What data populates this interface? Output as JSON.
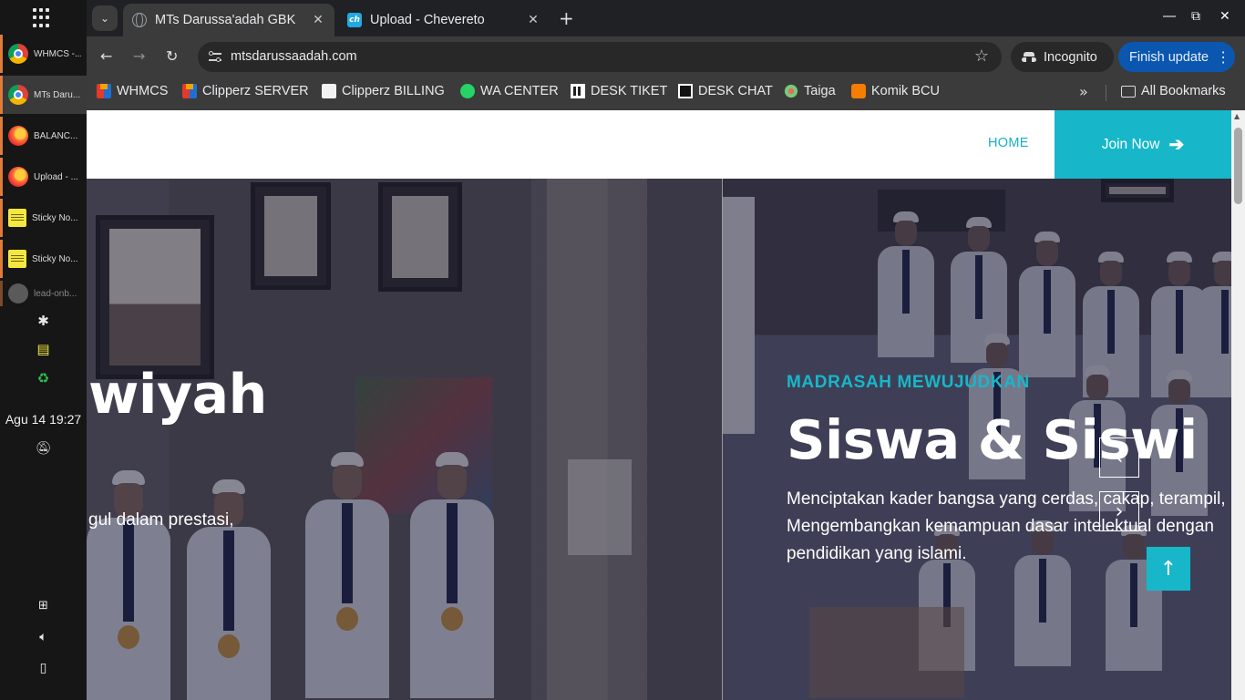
{
  "dock": {
    "windows": [
      {
        "label": "WHMCS -...",
        "icon": "chrome-icon",
        "active": false
      },
      {
        "label": "MTs Daru...",
        "icon": "chrome-icon",
        "active": true
      },
      {
        "label": "BALANC...",
        "icon": "firefox-icon",
        "active": false
      },
      {
        "label": "Upload - ...",
        "icon": "firefox-icon",
        "active": false
      },
      {
        "label": "Sticky No...",
        "icon": "sticky-notes-icon",
        "active": false
      },
      {
        "label": "Sticky No...",
        "icon": "sticky-notes-icon",
        "active": false
      },
      {
        "label": "lead-onb...",
        "icon": "app-icon",
        "active": false
      }
    ],
    "clock": "Agu 14  19:27"
  },
  "browser": {
    "tabs": [
      {
        "title": "MTs Darussa'adah GBK",
        "favicon": "globe-icon",
        "active": true
      },
      {
        "title": "Upload - Chevereto",
        "favicon": "chevereto-icon",
        "active": false
      }
    ],
    "favicon_text": "ch",
    "url": "mtsdarussaadah.com",
    "incognito_label": "Incognito",
    "update_label": "Finish update",
    "bookmarks": [
      {
        "label": "WHMCS",
        "icon": "cube-icon"
      },
      {
        "label": "Clipperz SERVER",
        "icon": "cube-icon"
      },
      {
        "label": "Clipperz BILLING",
        "icon": "clipperz-icon"
      },
      {
        "label": "WA CENTER",
        "icon": "whatsapp-icon"
      },
      {
        "label": "DESK TIKET",
        "icon": "desk-icon"
      },
      {
        "label": "DESK CHAT",
        "icon": "desk-chat-icon"
      },
      {
        "label": "Taiga",
        "icon": "taiga-icon"
      },
      {
        "label": "Komik BCU",
        "icon": "blogger-icon"
      }
    ],
    "all_bookmarks": "All Bookmarks"
  },
  "site": {
    "nav": {
      "home": "HOME",
      "join": "Join Now"
    },
    "slides": [
      {
        "title": "wiyah",
        "text": "gul dalam prestasi,"
      },
      {
        "kicker": "MADRASAH MEWUJUDKAN",
        "title": "Siswa & Siswi",
        "text_lines": [
          "Menciptakan kader bangsa yang cerdas, cakap, terampil,",
          "Mengembangkan kemampuan dasar intelektual dengan",
          "pendidikan yang islami."
        ]
      }
    ]
  },
  "colors": {
    "accent": "#17b7c9",
    "update_button": "#0b57b0",
    "chrome_bg": "#3b3b3b"
  }
}
